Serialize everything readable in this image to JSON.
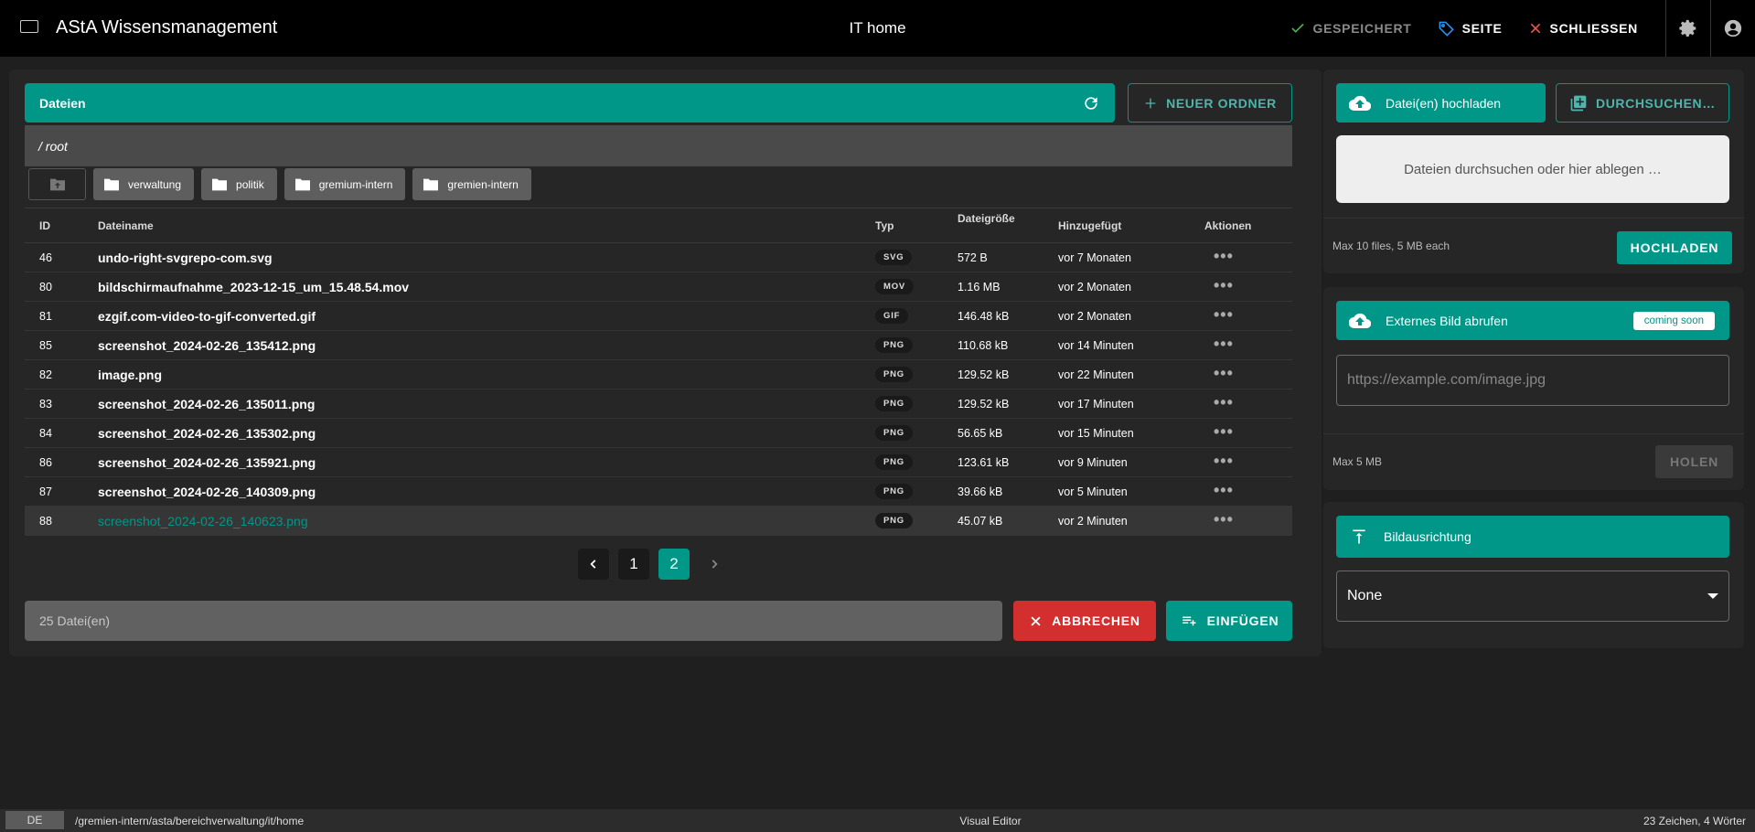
{
  "header": {
    "app_title": "AStA Wissensmanagement",
    "page_title": "IT home",
    "saved_label": "GESPEICHERT",
    "page_label": "SEITE",
    "close_label": "SCHLIESSEN"
  },
  "files_panel": {
    "title": "Dateien",
    "new_folder_label": "NEUER ORDNER",
    "path": "/ root",
    "folders": [
      "verwaltung",
      "politik",
      "gremium-intern",
      "gremien-intern"
    ],
    "columns": [
      "ID",
      "Dateiname",
      "Typ",
      "Dateigröße",
      "Hinzugefügt",
      "Aktionen"
    ],
    "rows": [
      {
        "id": "46",
        "name": "undo-right-svgrepo-com.svg",
        "type": "SVG",
        "size": "572 B",
        "added": "vor 7 Monaten"
      },
      {
        "id": "80",
        "name": "bildschirmaufnahme_2023-12-15_um_15.48.54.mov",
        "type": "MOV",
        "size": "1.16 MB",
        "added": "vor 2 Monaten"
      },
      {
        "id": "81",
        "name": "ezgif.com-video-to-gif-converted.gif",
        "type": "GIF",
        "size": "146.48 kB",
        "added": "vor 2 Monaten"
      },
      {
        "id": "85",
        "name": "screenshot_2024-02-26_135412.png",
        "type": "PNG",
        "size": "110.68 kB",
        "added": "vor 14 Minuten"
      },
      {
        "id": "82",
        "name": "image.png",
        "type": "PNG",
        "size": "129.52 kB",
        "added": "vor 22 Minuten"
      },
      {
        "id": "83",
        "name": "screenshot_2024-02-26_135011.png",
        "type": "PNG",
        "size": "129.52 kB",
        "added": "vor 17 Minuten"
      },
      {
        "id": "84",
        "name": "screenshot_2024-02-26_135302.png",
        "type": "PNG",
        "size": "56.65 kB",
        "added": "vor 15 Minuten"
      },
      {
        "id": "86",
        "name": "screenshot_2024-02-26_135921.png",
        "type": "PNG",
        "size": "123.61 kB",
        "added": "vor 9 Minuten"
      },
      {
        "id": "87",
        "name": "screenshot_2024-02-26_140309.png",
        "type": "PNG",
        "size": "39.66 kB",
        "added": "vor 5 Minuten"
      },
      {
        "id": "88",
        "name": "screenshot_2024-02-26_140623.png",
        "type": "PNG",
        "size": "45.07 kB",
        "added": "vor 2 Minuten",
        "selected": true
      }
    ],
    "pagination": {
      "pages": [
        "1",
        "2"
      ],
      "current": "2"
    },
    "file_count": "25 Datei(en)",
    "cancel_label": "ABBRECHEN",
    "insert_label": "EINFÜGEN"
  },
  "upload": {
    "tab_label": "Datei(en) hochladen",
    "browse_label": "DURCHSUCHEN…",
    "dropzone_text": "Dateien durchsuchen oder hier ablegen …",
    "limit_text": "Max 10 files, 5 MB each",
    "upload_label": "HOCHLADEN"
  },
  "external": {
    "title": "Externes Bild abrufen",
    "badge": "coming soon",
    "placeholder": "https://example.com/image.jpg",
    "limit_text": "Max 5 MB",
    "fetch_label": "HOLEN"
  },
  "orientation": {
    "title": "Bildausrichtung",
    "selected": "None"
  },
  "statusbar": {
    "language": "DE",
    "path": "/gremien-intern/asta/bereichverwaltung/it/home",
    "mode": "Visual Editor",
    "count": "23 Zeichen, 4 Wörter"
  },
  "colors": {
    "accent": "#009688",
    "danger": "#d32f2f",
    "success": "#4caf50"
  },
  "icons": [
    "logo-icon",
    "check-icon",
    "tag-icon",
    "close-icon",
    "gear-icon",
    "account-icon",
    "refresh-icon",
    "plus-icon",
    "folder-up-icon",
    "folder-icon",
    "more-horiz-icon",
    "chevron-left-icon",
    "chevron-right-icon",
    "playlist-add-icon",
    "cloud-upload-icon",
    "library-add-icon",
    "align-top-icon",
    "dropdown-arrow-icon"
  ]
}
